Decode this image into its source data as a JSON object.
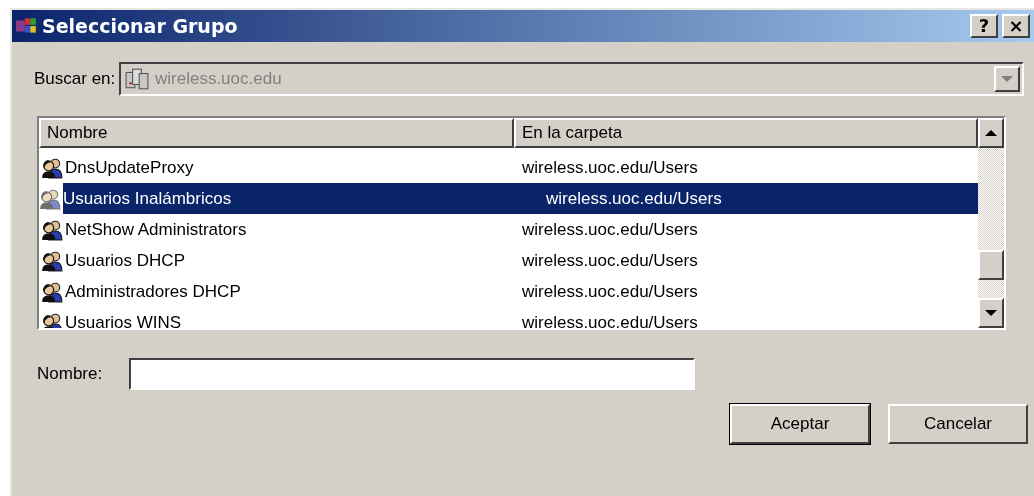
{
  "window": {
    "title": "Seleccionar Grupo",
    "help_button": "?",
    "close_button": "×"
  },
  "look_in": {
    "label": "Buscar en:",
    "value": "wireless.uoc.edu",
    "disabled": true
  },
  "table": {
    "columns": [
      "Nombre",
      "En la carpeta"
    ],
    "rows": [
      {
        "name": "DnsUpdateProxy",
        "folder": "wireless.uoc.edu/Users",
        "selected": false
      },
      {
        "name": "Usuarios Inalámbricos",
        "folder": "wireless.uoc.edu/Users",
        "selected": true
      },
      {
        "name": "NetShow Administrators",
        "folder": "wireless.uoc.edu/Users",
        "selected": false
      },
      {
        "name": "Usuarios DHCP",
        "folder": "wireless.uoc.edu/Users",
        "selected": false
      },
      {
        "name": "Administradores DHCP",
        "folder": "wireless.uoc.edu/Users",
        "selected": false
      },
      {
        "name": "Usuarios WINS",
        "folder": "wireless.uoc.edu/Users",
        "selected": false
      }
    ]
  },
  "name_field": {
    "label": "Nombre:"
  },
  "buttons": [
    "Aceptar",
    "Cancelar"
  ]
}
